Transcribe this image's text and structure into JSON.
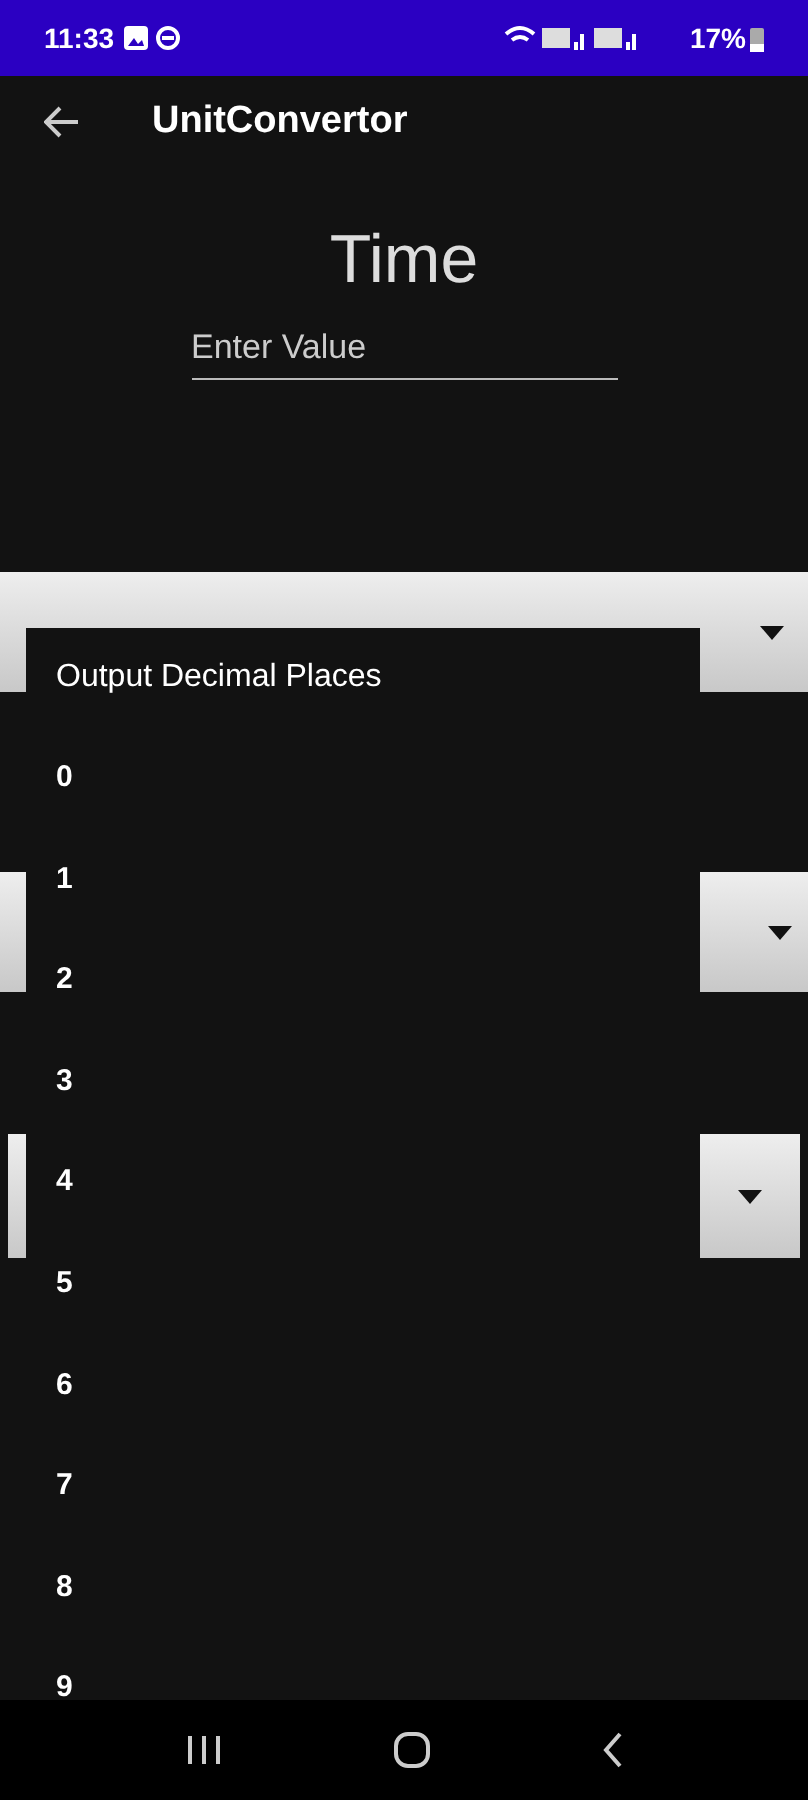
{
  "status_bar": {
    "time": "11:33",
    "battery": "17%"
  },
  "app_bar": {
    "title": "UnitConvertor"
  },
  "heading": "Time",
  "value_field": {
    "placeholder": "Enter Value"
  },
  "menu": {
    "title": "Output Decimal Places",
    "items": [
      "0",
      "1",
      "2",
      "3",
      "4",
      "5",
      "6",
      "7",
      "8",
      "9"
    ]
  }
}
